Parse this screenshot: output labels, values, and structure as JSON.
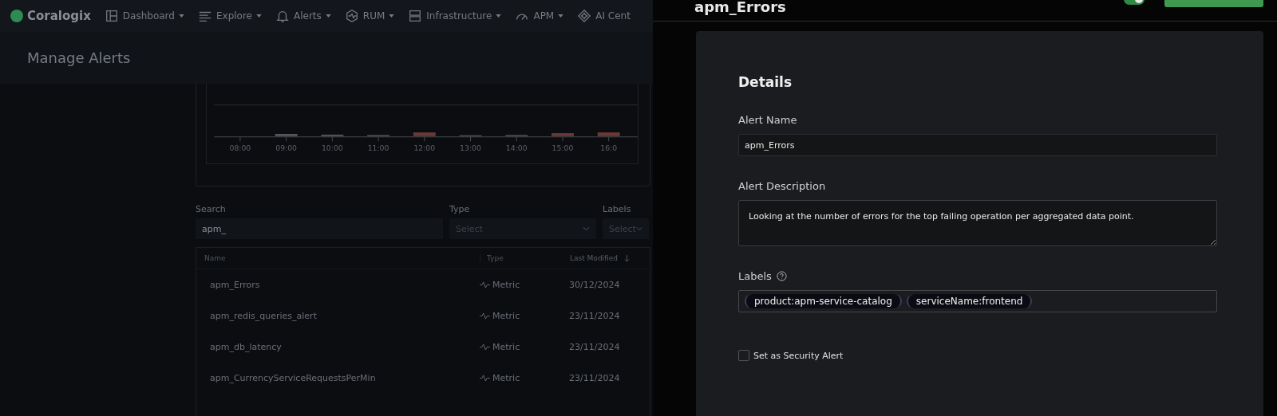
{
  "nav": {
    "brand": "Coralogix",
    "items": [
      {
        "label": "Dashboard"
      },
      {
        "label": "Explore"
      },
      {
        "label": "Alerts"
      },
      {
        "label": "RUM"
      },
      {
        "label": "Infrastructure"
      },
      {
        "label": "APM"
      },
      {
        "label": "AI Cent"
      }
    ]
  },
  "page": {
    "title": "Manage Alerts"
  },
  "chart": {
    "x_labels": [
      "08:00",
      "09:00",
      "10:00",
      "11:00",
      "12:00",
      "13:00",
      "14:00",
      "15:00",
      "16:0"
    ]
  },
  "filters": [
    {
      "label": "Search",
      "kind": "text",
      "value": "apm_"
    },
    {
      "label": "Type",
      "kind": "select",
      "placeholder": "Select"
    },
    {
      "label": "Labels",
      "kind": "select",
      "placeholder": "Select"
    }
  ],
  "table": {
    "columns": [
      {
        "label": "Name",
        "sorted": false
      },
      {
        "label": "Type",
        "sorted": false
      },
      {
        "label": "Last Modified",
        "sorted": true
      }
    ],
    "rows": [
      {
        "name": "apm_Errors",
        "type": "Metric",
        "modified": "30/12/2024"
      },
      {
        "name": "apm_redis_queries_alert",
        "type": "Metric",
        "modified": "23/11/2024"
      },
      {
        "name": "apm_db_latency",
        "type": "Metric",
        "modified": "23/11/2024"
      },
      {
        "name": "apm_CurrencyServiceRequestsPerMin",
        "type": "Metric",
        "modified": "23/11/2024"
      }
    ]
  },
  "panel": {
    "title": "apm_Errors",
    "toggle_on": true,
    "section": "Details",
    "alert_name": {
      "label": "Alert Name",
      "value": "apm_Errors"
    },
    "description": {
      "label": "Alert Description",
      "value": "Looking at the number of errors for the top failing operation per aggregated data point."
    },
    "labels": {
      "label": "Labels",
      "tags": [
        "product:apm-service-catalog",
        "serviceName:frontend"
      ]
    },
    "security": {
      "label": "Set as Security Alert",
      "checked": false
    }
  }
}
